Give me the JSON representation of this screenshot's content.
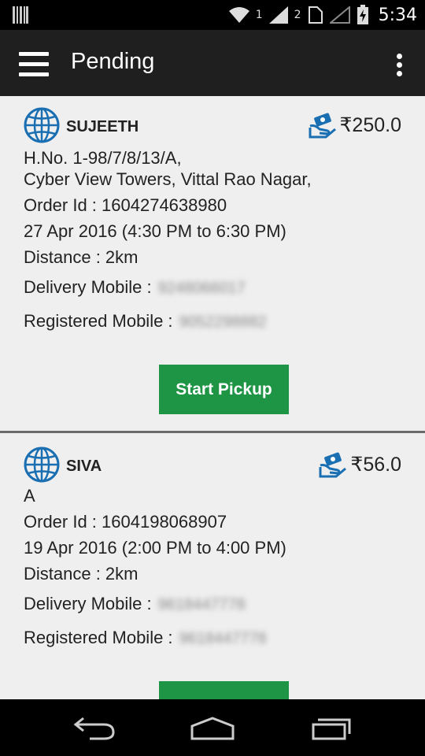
{
  "status_bar": {
    "sim1": "1",
    "sim2": "2",
    "time": "5:34"
  },
  "app_bar": {
    "title": "Pending",
    "icons": [
      "menu-icon",
      "overflow-menu-icon"
    ]
  },
  "orders": [
    {
      "name": "SUJEETH",
      "price": "₹250.0",
      "address_lines": [
        "H.No. 1-98/7/8/13/A,",
        "Cyber View Towers, Vittal Rao Nagar,"
      ],
      "order_id": "Order Id : 1604274638980",
      "date": "27 Apr 2016 (4:30 PM to 6:30 PM)",
      "distance": "Distance : 2km",
      "delivery_mobile_label": "Delivery Mobile :",
      "delivery_mobile": "9248066017",
      "registered_mobile_label": "Registered Mobile :",
      "registered_mobile": "9052298882",
      "button_label": "Start Pickup"
    },
    {
      "name": "SIVA",
      "price": "₹56.0",
      "address_lines": [
        "A"
      ],
      "order_id": "Order Id : 1604198068907",
      "date": "19 Apr 2016 (2:00 PM to 4:00 PM)",
      "distance": "Distance : 2km",
      "delivery_mobile_label": "Delivery Mobile :",
      "delivery_mobile": "9618447778",
      "registered_mobile_label": "Registered Mobile :",
      "registered_mobile": "9618447778"
    }
  ],
  "colors": {
    "accent_green": "#1e9445",
    "app_bar": "#1f1f1f",
    "globe_blue": "#1a6fb3"
  },
  "nav_bar": {
    "icons": [
      "back-icon",
      "home-icon",
      "recent-apps-icon"
    ]
  }
}
